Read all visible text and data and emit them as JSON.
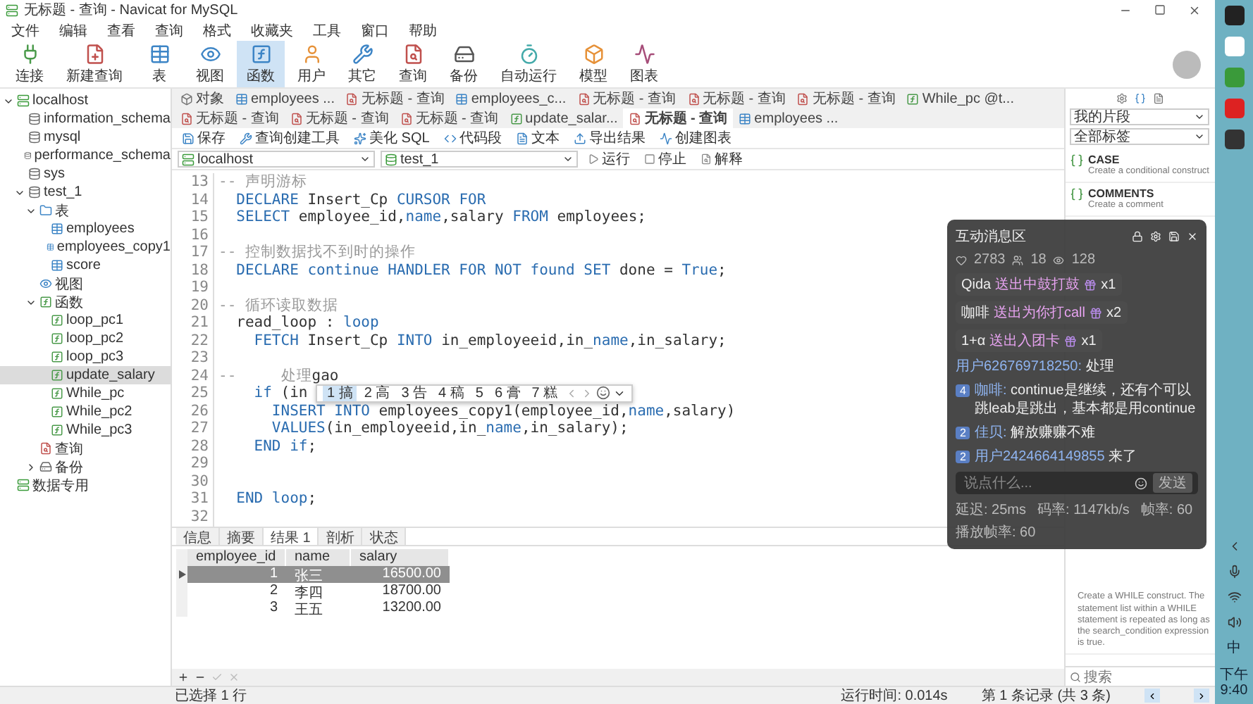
{
  "window": {
    "title": "无标题 - 查询 - Navicat for MySQL"
  },
  "menu": [
    "文件",
    "编辑",
    "查看",
    "查询",
    "格式",
    "收藏夹",
    "工具",
    "窗口",
    "帮助"
  ],
  "toolbar": [
    {
      "label": "连接",
      "selected": false
    },
    {
      "label": "新建查询",
      "selected": false
    },
    {
      "label": "表",
      "selected": false
    },
    {
      "label": "视图",
      "selected": false
    },
    {
      "label": "函数",
      "selected": true
    },
    {
      "label": "用户",
      "selected": false
    },
    {
      "label": "其它",
      "selected": false
    },
    {
      "label": "查询",
      "selected": false
    },
    {
      "label": "备份",
      "selected": false
    },
    {
      "label": "自动运行",
      "selected": false
    },
    {
      "label": "模型",
      "selected": false
    },
    {
      "label": "图表",
      "selected": false
    }
  ],
  "tree": [
    {
      "label": "localhost",
      "kind": "server",
      "expanded": true,
      "selected": false,
      "children": [
        {
          "label": "information_schema",
          "kind": "database",
          "selected": false
        },
        {
          "label": "mysql",
          "kind": "database",
          "selected": false
        },
        {
          "label": "performance_schema",
          "kind": "database",
          "selected": false
        },
        {
          "label": "sys",
          "kind": "database",
          "selected": false
        },
        {
          "label": "test_1",
          "kind": "database",
          "expanded": true,
          "selected": false,
          "children": [
            {
              "label": "表",
              "kind": "folder",
              "expanded": true,
              "selected": false,
              "children": [
                {
                  "label": "employees",
                  "kind": "table",
                  "selected": false
                },
                {
                  "label": "employees_copy1",
                  "kind": "table",
                  "selected": false
                },
                {
                  "label": "score",
                  "kind": "table",
                  "selected": false
                }
              ]
            },
            {
              "label": "视图",
              "kind": "view",
              "selected": false
            },
            {
              "label": "函数",
              "kind": "function",
              "expanded": true,
              "selected": false,
              "children": [
                {
                  "label": "loop_pc1",
                  "kind": "function",
                  "selected": false
                },
                {
                  "label": "loop_pc2",
                  "kind": "function",
                  "selected": false
                },
                {
                  "label": "loop_pc3",
                  "kind": "function",
                  "selected": false
                },
                {
                  "label": "update_salary",
                  "kind": "function",
                  "selected": true
                },
                {
                  "label": "While_pc",
                  "kind": "function",
                  "selected": false
                },
                {
                  "label": "While_pc2",
                  "kind": "function",
                  "selected": false
                },
                {
                  "label": "While_pc3",
                  "kind": "function",
                  "selected": false
                }
              ]
            },
            {
              "label": "查询",
              "kind": "query",
              "selected": false
            },
            {
              "label": "备份",
              "kind": "backup",
              "expanded": false,
              "selected": false
            }
          ]
        }
      ]
    },
    {
      "label": "数据专用",
      "kind": "server",
      "selected": false
    }
  ],
  "tabs": [
    {
      "label": "对象",
      "kind": "object",
      "selected": false
    },
    {
      "label": "employees ...",
      "kind": "table",
      "selected": false
    },
    {
      "label": "无标题 - 查询",
      "kind": "query",
      "selected": false
    },
    {
      "label": "employees_c...",
      "kind": "table",
      "selected": false
    },
    {
      "label": "无标题 - 查询",
      "kind": "query",
      "selected": false
    },
    {
      "label": "无标题 - 查询",
      "kind": "query",
      "selected": false
    },
    {
      "label": "无标题 - 查询",
      "kind": "query",
      "selected": false
    },
    {
      "label": "While_pc @t...",
      "kind": "function",
      "selected": false
    },
    {
      "label": "无标题 - 查询",
      "kind": "query",
      "selected": false
    },
    {
      "label": "无标题 - 查询",
      "kind": "query",
      "selected": false
    },
    {
      "label": "无标题 - 查询",
      "kind": "query",
      "selected": false
    },
    {
      "label": "update_salar...",
      "kind": "function",
      "selected": false
    },
    {
      "label": "无标题 - 查询",
      "kind": "query",
      "selected": true
    },
    {
      "label": "employees ...",
      "kind": "table",
      "selected": false
    }
  ],
  "query_toolbar": [
    "保存",
    "查询创建工具",
    "美化 SQL",
    "代码段",
    "文本",
    "导出结果",
    "创建图表"
  ],
  "connection": {
    "server": "localhost",
    "database": "test_1",
    "actions": [
      "运行",
      "停止",
      "解释"
    ]
  },
  "code": [
    {
      "line": "13",
      "tokens": [
        {
          "kind": "comment",
          "text": "-- 声明游标"
        }
      ]
    },
    {
      "line": "14",
      "tokens": [
        {
          "kind": "keyword",
          "text": "  DECLARE"
        },
        {
          "kind": "text",
          "text": " Insert_Cp "
        },
        {
          "kind": "keyword",
          "text": "CURSOR FOR"
        }
      ]
    },
    {
      "line": "15",
      "tokens": [
        {
          "kind": "keyword",
          "text": "  SELECT"
        },
        {
          "kind": "text",
          "text": " employee_id,"
        },
        {
          "kind": "keyword",
          "text": "name"
        },
        {
          "kind": "text",
          "text": ",salary "
        },
        {
          "kind": "keyword",
          "text": "FROM"
        },
        {
          "kind": "text",
          "text": " employees;"
        }
      ]
    },
    {
      "line": "16"
    },
    {
      "line": "17",
      "tokens": [
        {
          "kind": "comment",
          "text": "-- 控制数据找不到时的操作"
        }
      ]
    },
    {
      "line": "18",
      "tokens": [
        {
          "kind": "keyword",
          "text": "  DECLARE continue HANDLER FOR NOT found SET"
        },
        {
          "kind": "text",
          "text": " done = "
        },
        {
          "kind": "keyword",
          "text": "True"
        },
        {
          "kind": "text",
          "text": ";"
        }
      ]
    },
    {
      "line": "19"
    },
    {
      "line": "20",
      "tokens": [
        {
          "kind": "comment",
          "text": "-- 循环读取数据"
        }
      ]
    },
    {
      "line": "21",
      "tokens": [
        {
          "kind": "text",
          "text": "  read_loop : "
        },
        {
          "kind": "keyword",
          "text": "loop"
        }
      ]
    },
    {
      "line": "22",
      "tokens": [
        {
          "kind": "keyword",
          "text": "    FETCH"
        },
        {
          "kind": "text",
          "text": " Insert_Cp "
        },
        {
          "kind": "keyword",
          "text": "INTO"
        },
        {
          "kind": "text",
          "text": " in_employeeid,in_"
        },
        {
          "kind": "keyword",
          "text": "name"
        },
        {
          "kind": "text",
          "text": ",in_salary;"
        }
      ]
    },
    {
      "line": "23"
    },
    {
      "line": "24",
      "tokens": [
        {
          "kind": "comment",
          "text": "--     处理"
        },
        {
          "kind": "text",
          "text": "gao"
        }
      ]
    },
    {
      "line": "25",
      "tokens": [
        {
          "kind": "keyword",
          "text": "    if"
        },
        {
          "kind": "text",
          "text": " (in"
        }
      ]
    },
    {
      "line": "26",
      "tokens": [
        {
          "kind": "keyword",
          "text": "      INSERT INTO"
        },
        {
          "kind": "text",
          "text": " employees_copy1(employee_id,"
        },
        {
          "kind": "keyword",
          "text": "name"
        },
        {
          "kind": "text",
          "text": ",salary)"
        }
      ]
    },
    {
      "line": "27",
      "tokens": [
        {
          "kind": "keyword",
          "text": "      VALUES"
        },
        {
          "kind": "text",
          "text": "(in_employeeid,in_"
        },
        {
          "kind": "keyword",
          "text": "name"
        },
        {
          "kind": "text",
          "text": ",in_salary);"
        }
      ]
    },
    {
      "line": "28",
      "tokens": [
        {
          "kind": "keyword",
          "text": "    END if"
        },
        {
          "kind": "text",
          "text": ";"
        }
      ]
    },
    {
      "line": "29"
    },
    {
      "line": "30"
    },
    {
      "line": "31",
      "tokens": [
        {
          "kind": "keyword",
          "text": "  END loop"
        },
        {
          "kind": "text",
          "text": ";"
        }
      ]
    },
    {
      "line": "32"
    }
  ],
  "ime": {
    "candidates": [
      {
        "text": "1 搞",
        "selected": true
      },
      {
        "text": "2 高",
        "selected": false
      },
      {
        "text": "3 告",
        "selected": false
      },
      {
        "text": "4 稿",
        "selected": false
      },
      {
        "text": "5",
        "selected": false
      },
      {
        "text": "6 膏",
        "selected": false
      },
      {
        "text": "7 糕",
        "selected": false
      }
    ]
  },
  "result_tabs": [
    {
      "label": "信息",
      "selected": false
    },
    {
      "label": "摘要",
      "selected": false
    },
    {
      "label": "结果 1",
      "selected": true
    },
    {
      "label": "剖析",
      "selected": false
    },
    {
      "label": "状态",
      "selected": false
    }
  ],
  "grid": {
    "columns": [
      "employee_id",
      "name",
      "salary"
    ],
    "rows": [
      {
        "cells": [
          "1",
          "张三",
          "16500.00"
        ],
        "selected": true
      },
      {
        "cells": [
          "2",
          "李四",
          "18700.00"
        ],
        "selected": false
      },
      {
        "cells": [
          "3",
          "王五",
          "13200.00"
        ],
        "selected": false
      }
    ]
  },
  "status_bar": {
    "selection": "已选择 1 行",
    "runtime": "运行时间: 0.014s",
    "records": "第 1 条记录 (共 3 条)"
  },
  "snippets": {
    "filter": "我的片段",
    "tags": "全部标签",
    "items": [
      {
        "title": "CASE",
        "description": "Create a conditional construct"
      },
      {
        "title": "COMMENTS",
        "description": "Create a comment"
      }
    ],
    "last_description": "Create a WHILE construct. The statement list within a WHILE statement is repeated as long as the search_condition expression is true.",
    "search_placeholder": "搜索"
  },
  "chat": {
    "title": "互动消息区",
    "stats": [
      "2783",
      "18",
      "128"
    ],
    "gifts": [
      {
        "user": "Qida",
        "text": "送出中鼓打鼓",
        "count": "x1"
      },
      {
        "user": "咖啡",
        "text": "送出为你打call",
        "count": "x2"
      },
      {
        "user": "1+α",
        "text": "送出入团卡",
        "count": "x1"
      }
    ],
    "messages": [
      {
        "kind": "plain",
        "user": "用户626769718250:",
        "text": "处理"
      },
      {
        "kind": "fan",
        "badge": "4",
        "user": "咖啡:",
        "text": "continue是继续，还有个可以跳leab是跳出，基本都是用continue"
      },
      {
        "kind": "fan",
        "badge": "2",
        "user": "佳贝:",
        "text": "解放赚赚不难"
      },
      {
        "kind": "fan",
        "badge": "2",
        "user": "用户2424664149855",
        "text": "来了"
      }
    ],
    "placeholder": "说点什么...",
    "send": "发送",
    "footer": [
      "延迟: 25ms",
      "码率: 1147kb/s",
      "帧率: 60",
      "播放帧率: 60"
    ]
  },
  "taskbar": {
    "ime": "中",
    "time": "下午 9:40"
  }
}
